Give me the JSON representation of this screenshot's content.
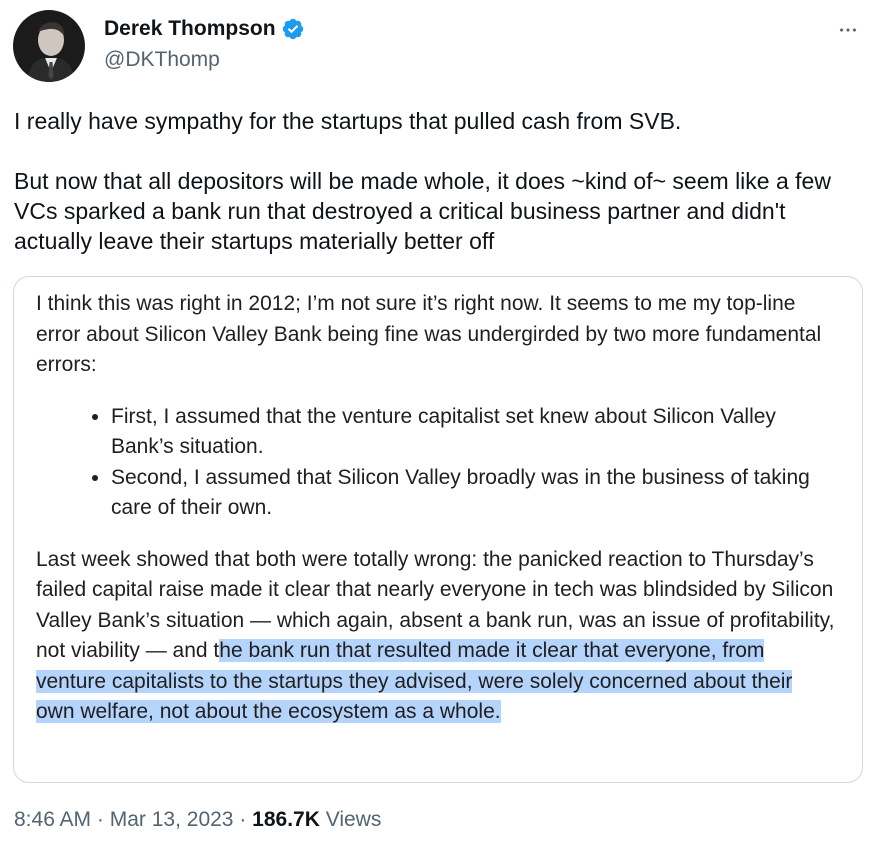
{
  "author": {
    "display_name": "Derek Thompson",
    "handle": "@DKThomp",
    "verified": true,
    "avatar_icon": "profile-photo",
    "verified_icon": "verified-badge-icon",
    "verified_color": "#1d9bf0"
  },
  "more_icon": "more-options-icon",
  "tweet": {
    "paragraph_1": "I really have sympathy for the startups that pulled cash from SVB.",
    "paragraph_2": "But now that all depositors will be made whole, it does ~kind of~ seem like a few VCs sparked a bank run that destroyed a critical business partner and didn't actually leave their startups materially better off"
  },
  "quote_image": {
    "intro": "I think this was right in 2012; I’m not sure it’s right now. It seems to me my top-line error about Silicon Valley Bank being fine was undergirded by two more fundamental errors:",
    "bullets": [
      "First, I assumed that the venture capitalist set knew about Silicon Valley Bank’s situation.",
      "Second, I assumed that Silicon Valley broadly was in the business of taking care of their own."
    ],
    "conclusion_plain": "Last week showed that both were totally wrong: the panicked reaction to Thursday’s failed capital raise made it clear that nearly everyone in tech was blindsided by Silicon Valley Bank’s situation — which again, absent a bank run, was an issue of profitability, not viability — and t",
    "conclusion_highlighted": "he bank run that resulted made it clear that everyone, from venture capitalists to the startups they advised, were solely concerned about their own welfare, not about the ecosystem as a whole.",
    "highlight_color": "#b4d4fc"
  },
  "meta": {
    "time": "8:46 AM",
    "separator_1": " · ",
    "date": "Mar 13, 2023",
    "separator_2": " · ",
    "views_count": "186.7K",
    "views_label": " Views"
  }
}
